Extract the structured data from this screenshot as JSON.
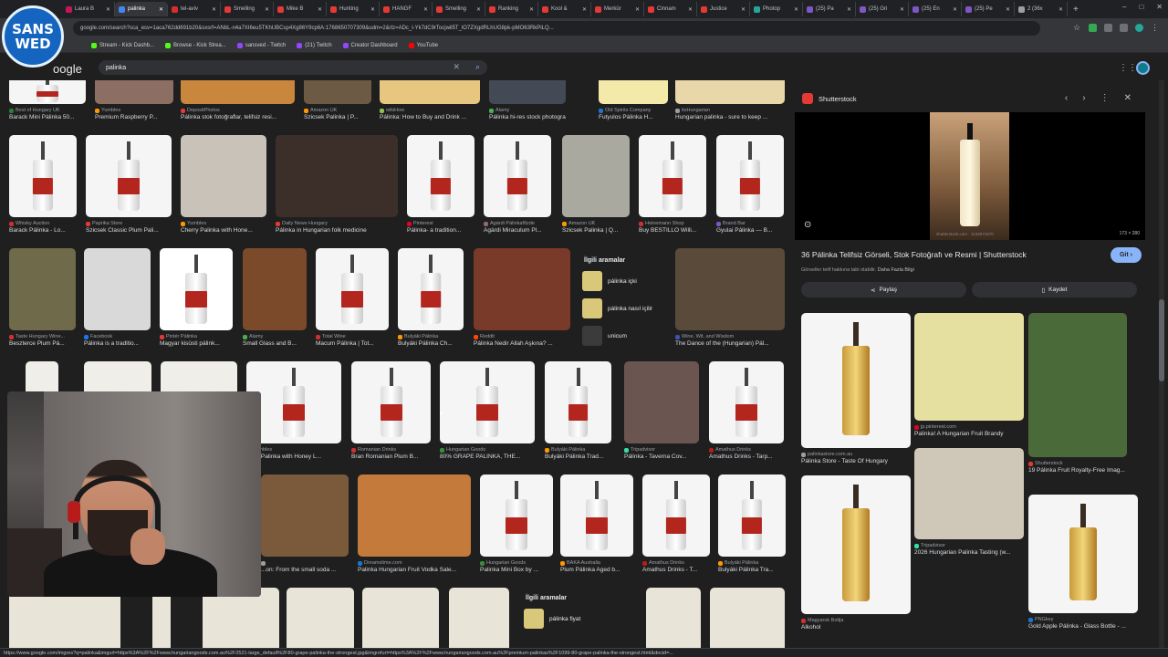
{
  "browser": {
    "tabs": [
      {
        "label": "Laura B",
        "color": "#c2185b"
      },
      {
        "label": "palinka",
        "color": "#4285f4",
        "active": true
      },
      {
        "label": "tel-aviv",
        "color": "#d32f2f"
      },
      {
        "label": "Smelling",
        "color": "#e53935"
      },
      {
        "label": "Mike B",
        "color": "#e53935"
      },
      {
        "label": "Hunting",
        "color": "#e53935"
      },
      {
        "label": "HANGF",
        "color": "#e53935"
      },
      {
        "label": "Smelling",
        "color": "#e53935"
      },
      {
        "label": "Ranking",
        "color": "#e53935"
      },
      {
        "label": "Kool &",
        "color": "#e53935"
      },
      {
        "label": "Merkür",
        "color": "#e53935"
      },
      {
        "label": "Cinnam",
        "color": "#e53935"
      },
      {
        "label": "Justice",
        "color": "#e53935"
      },
      {
        "label": "Photop",
        "color": "#26a69a"
      },
      {
        "label": "(25) Pa",
        "color": "#7e57c2"
      },
      {
        "label": "(25) Gri",
        "color": "#7e57c2"
      },
      {
        "label": "(25) En",
        "color": "#7e57c2"
      },
      {
        "label": "(25) Pe",
        "color": "#7e57c2"
      },
      {
        "label": "2 (36x",
        "color": "#9e9e9e"
      }
    ],
    "new_tab": "+",
    "url": "google.com/search?sca_esv=1aca762dd691b20&sxsrf=ANbL-n4a7XI6eu5TKhUBCsp4Xg86Y9cp6A:1768650707309&udm=2&rlz=ADc_l-Yk7dC9rTocjwil5T_lO7ZXgdRLhUG8pk-pMO63RkPiLQ...",
    "bookmarks": [
      {
        "label": "Stream - Kick Dashb...",
        "color": "#53fc18"
      },
      {
        "label": "Browse - Kick Strea...",
        "color": "#53fc18"
      },
      {
        "label": "sansved - Twitch",
        "color": "#9146ff"
      },
      {
        "label": "(21) Twitch",
        "color": "#9146ff"
      },
      {
        "label": "Creator Dashboard",
        "color": "#9146ff"
      },
      {
        "label": "YouTube",
        "color": "#ff0000"
      }
    ]
  },
  "overlay_logo": {
    "line1": "SANS",
    "line2": "WED"
  },
  "google": {
    "logo": "oogle",
    "search_query": "palinka"
  },
  "grid": {
    "row0": [
      {
        "src": "Best of Hungary UK",
        "title": "Barack Mini Pálinka 50...",
        "color": "#f5f5f5",
        "fav": "#2e7d32"
      },
      {
        "src": "Yumbles",
        "title": "Premium Raspberry P...",
        "color": "#8d6e63",
        "fav": "#ff9800"
      },
      {
        "src": "DepositPhotos",
        "title": "Pálinka stok fotoğraflar, telifsiz resi...",
        "color": "#c9863d",
        "fav": "#e53935"
      },
      {
        "src": "Amazon UK",
        "title": "Szicsek Palinka | P...",
        "color": "#6d5a44",
        "fav": "#ff9900"
      },
      {
        "src": "wikiHow",
        "title": "Pálinka: How to Buy and Drink ...",
        "color": "#e7c77f",
        "fav": "#8bc34a"
      },
      {
        "src": "Alamy",
        "title": "Pálinka hi-res stock photograph...",
        "color": "#444a55",
        "fav": "#4caf50"
      },
      {
        "src": "Old Spirits Company",
        "title": "Futyulos Pálinka H...",
        "color": "#f3e9a8",
        "fav": "#1976d2"
      },
      {
        "src": "itsHungarian",
        "title": "Hungarian palinka - sure to keep ...",
        "color": "#e8d7a8",
        "fav": "#9e9e9e"
      }
    ],
    "row1": [
      {
        "src": "Whisky Auction",
        "title": "Barack Pálinka - Lo...",
        "color": "#f5f5f5",
        "fav": "#d32f2f"
      },
      {
        "src": "Paprika Store",
        "title": "Szicsek Classic Plum Pali...",
        "color": "#f5f5f5",
        "fav": "#e53935"
      },
      {
        "src": "Yumbles",
        "title": "Cherry Palinka with Hone...",
        "color": "#c9c2b8",
        "fav": "#ff9800"
      },
      {
        "src": "Daily News Hungary",
        "title": "Pálinka in Hungarian folk medicine",
        "color": "#3c2f2a",
        "fav": "#e53935"
      },
      {
        "src": "Pinterest",
        "title": "Pálinka- a tradition...",
        "color": "#f5f5f5",
        "fav": "#e60023"
      },
      {
        "src": "Agárdi Pálinkafőzde",
        "title": "Agárdi Miraculum Pl...",
        "color": "#f5f5f5",
        "fav": "#8d6e63"
      },
      {
        "src": "Amazon UK",
        "title": "Szicsek Palinka | Q...",
        "color": "#a9a9a0",
        "fav": "#ff9900"
      },
      {
        "src": "Heinemann Shop",
        "title": "Buy BESTILLO Willi...",
        "color": "#f5f5f5",
        "fav": "#d32f2f"
      },
      {
        "src": "Brand Bar",
        "title": "Gyulai Pálinka — B...",
        "color": "#f5f5f5",
        "fav": "#7e57c2"
      }
    ],
    "row2": [
      {
        "src": "Taste Hungary Wine...",
        "title": "Beszterce Plum Pá...",
        "color": "#6f6a4a",
        "fav": "#d32f2f"
      },
      {
        "src": "Facebook",
        "title": "Pálinka is a traditio...",
        "color": "#d9d9d9",
        "fav": "#1877f2"
      },
      {
        "src": "Pintér Pálinka",
        "title": "Magyar kisüsti pálink...",
        "color": "#ffffff",
        "fav": "#e53935"
      },
      {
        "src": "Alamy",
        "title": "Small Glass and B...",
        "color": "#7a4a2a",
        "fav": "#4caf50"
      },
      {
        "src": "Total Wine",
        "title": "Macum Pálinka | Tot...",
        "color": "#f5f5f5",
        "fav": "#d32f2f"
      },
      {
        "src": "Bulyáki Pálinka",
        "title": "Bulyáki Pálinka Ch...",
        "color": "#f5f5f5",
        "fav": "#ff9800"
      },
      {
        "src": "Reddit",
        "title": "Pálinka Nedir Allah Aşkına? ...",
        "color": "#7a3a2a",
        "fav": "#ff4500"
      },
      {
        "src": "Wine, Wit, and Wisdom",
        "title": "The Dance of the (Hungarian) Pál...",
        "color": "#5a4a3a",
        "fav": "#3f51b5"
      }
    ],
    "related1": {
      "heading": "İlgili aramalar",
      "items": [
        "pálinka içki",
        "pálinka nasıl içilir",
        "unicum"
      ]
    },
    "row3": [
      {
        "src": "Yumbles",
        "title": "...cot Palinka with Honey L...",
        "color": "#f5f5f5",
        "fav": "#ff9800"
      },
      {
        "src": "Romanian Drinks",
        "title": "Bran Romanian Plum B...",
        "color": "#f5f5f5",
        "fav": "#d32f2f"
      },
      {
        "src": "Hungarian Goods",
        "title": "80% GRAPE PALINKA, THE...",
        "color": "#f5f5f5",
        "fav": "#388e3c"
      },
      {
        "src": "Bulyáki Pálinka",
        "title": "Bulyáki Pálinka Trad...",
        "color": "#f5f5f5",
        "fav": "#ff9800"
      },
      {
        "src": "Tripadvisor",
        "title": "Pálinka - Taverna Cov...",
        "color": "#6b5550",
        "fav": "#34e0a1"
      },
      {
        "src": "Amathus Drinks",
        "title": "Amathus Drinks - Tarp...",
        "color": "#f5f5f5",
        "fav": "#b71c1c"
      }
    ],
    "row4": [
      {
        "src": "",
        "title": "...on: From the small soda ...",
        "color": "#7a5a3a",
        "fav": "#9e9e9e"
      },
      {
        "src": "Dreamstime.com",
        "title": "Palinka Hungarian Fruit Vodka Sale...",
        "color": "#c47a3a",
        "fav": "#1976d2"
      },
      {
        "src": "Hungarian Goods",
        "title": "Palinka Mini Box by ...",
        "color": "#f5f5f5",
        "fav": "#388e3c"
      },
      {
        "src": "BAKA Australia",
        "title": "Plum Pálinka Aged b...",
        "color": "#f5f5f5",
        "fav": "#ff9800"
      },
      {
        "src": "Amathus Drinks",
        "title": "Amathus Drinks - T...",
        "color": "#f5f5f5",
        "fav": "#b71c1c"
      },
      {
        "src": "Bulyáki Pálinka",
        "title": "Bulyáki Pálinka Tra...",
        "color": "#f5f5f5",
        "fav": "#ff9800"
      }
    ],
    "related2": {
      "heading": "İlgili aramalar",
      "items": [
        "pálinka fiyat"
      ]
    }
  },
  "panel": {
    "source": "Shutterstock",
    "credit": "shutterstock.com · 1132871570",
    "dimensions": "173 × 280",
    "title": "36 Pálinka Telifsiz Görseli, Stok Fotoğrafı ve Resmi | Shutterstock",
    "visit_label": "Git",
    "subtitle": "Görseller telif hakkına tabi olabilir.",
    "subtitle_link": "Daha Fazla Bilgi",
    "share_label": "Paylaş",
    "save_label": "Kaydet",
    "related": [
      {
        "src": "palinkastore.com.au",
        "title": "Pálinka Store - Taste Of Hungary",
        "color": "#f5f5f5",
        "fav": "#9e9e9e"
      },
      {
        "src": "jp.pinterest.com",
        "title": "Palinka! A Hungarian Fruit Brandy",
        "color": "#e6e0a0",
        "fav": "#e60023"
      },
      {
        "src": "Shutterstock",
        "title": "19 Pálinka Fruit Royalty-Free Imag...",
        "color": "#4b6a3a",
        "fav": "#e53935"
      },
      {
        "src": "Tripadvisor",
        "title": "2026 Hungarian Palinka Tasting (w...",
        "color": "#cfc7b8",
        "fav": "#34e0a1"
      },
      {
        "src": "Magyarok Boltja",
        "title": "Alkohol",
        "color": "#f5f5f5",
        "fav": "#d32f2f"
      },
      {
        "src": "PNGkey",
        "title": "Gold Apple Pálinka - Glass Bottle - ...",
        "color": "#f5f5f5",
        "fav": "#1976d2"
      }
    ]
  },
  "status_url": "https://www.google.com/imgres?q=palinka&imgurl=https%3A%2F%2Fwww.hungariangoods.com.au%2F2521-large_default%2F80-grape-palinka-the-strongest.jpg&imgrefurl=https%3A%2F%2Fwww.hungariangoods.com.au%2Fpremium-palinkas%2F1099-80-grape-palinka-the-strongest.html&docid=..."
}
